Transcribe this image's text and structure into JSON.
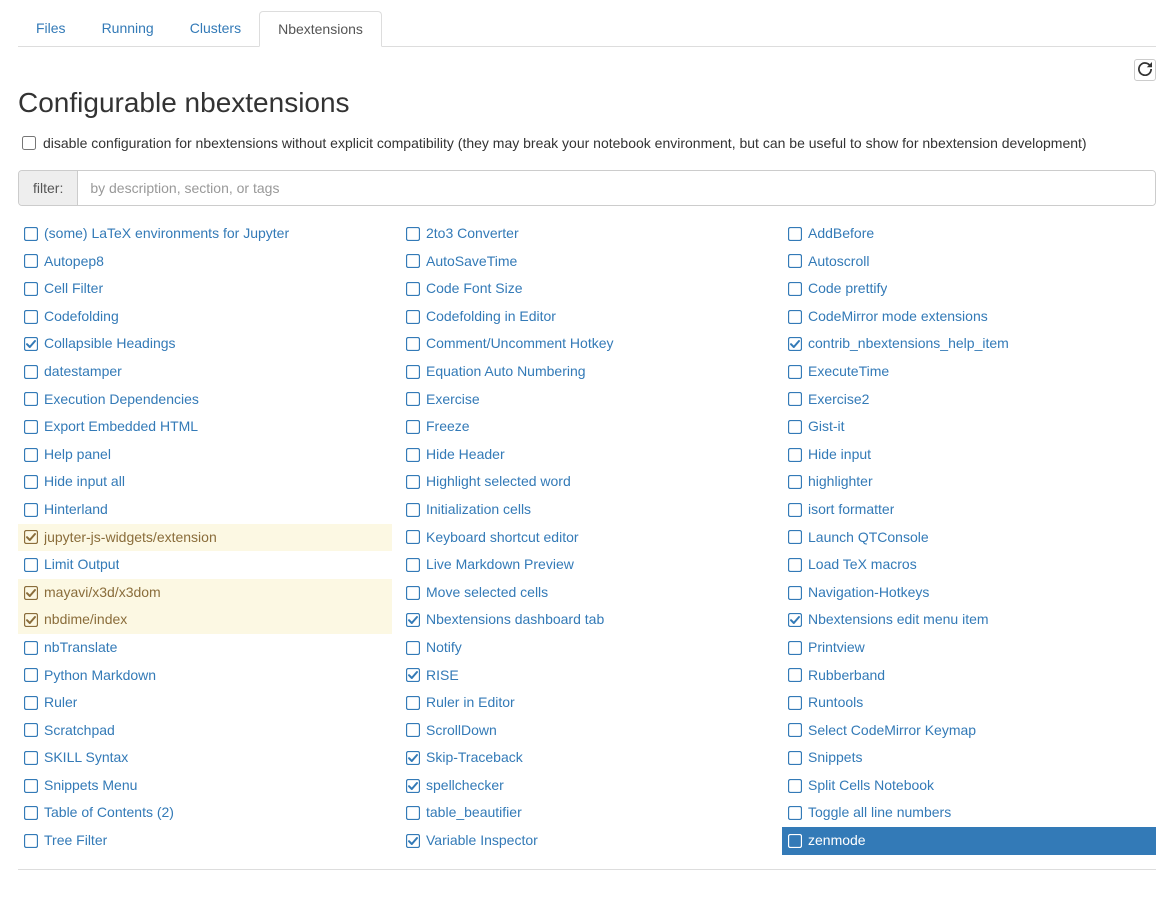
{
  "tabs": {
    "files": "Files",
    "running": "Running",
    "clusters": "Clusters",
    "nbextensions": "Nbextensions",
    "active": "nbextensions"
  },
  "title": "Configurable nbextensions",
  "disable_compat_label": "disable configuration for nbextensions without explicit compatibility (they may break your notebook environment, but can be useful to show for nbextension development)",
  "filter": {
    "label": "filter:",
    "placeholder": "by description, section, or tags"
  },
  "columns": [
    [
      {
        "label": "(some) LaTeX environments for Jupyter",
        "checked": false
      },
      {
        "label": "Autopep8",
        "checked": false
      },
      {
        "label": "Cell Filter",
        "checked": false
      },
      {
        "label": "Codefolding",
        "checked": false
      },
      {
        "label": "Collapsible Headings",
        "checked": true
      },
      {
        "label": "datestamper",
        "checked": false
      },
      {
        "label": "Execution Dependencies",
        "checked": false
      },
      {
        "label": "Export Embedded HTML",
        "checked": false
      },
      {
        "label": "Help panel",
        "checked": false
      },
      {
        "label": "Hide input all",
        "checked": false
      },
      {
        "label": "Hinterland",
        "checked": false
      },
      {
        "label": "jupyter-js-widgets/extension",
        "checked": true,
        "nocompat": true
      },
      {
        "label": "Limit Output",
        "checked": false
      },
      {
        "label": "mayavi/x3d/x3dom",
        "checked": true,
        "nocompat": true
      },
      {
        "label": "nbdime/index",
        "checked": true,
        "nocompat": true
      },
      {
        "label": "nbTranslate",
        "checked": false
      },
      {
        "label": "Python Markdown",
        "checked": false
      },
      {
        "label": "Ruler",
        "checked": false
      },
      {
        "label": "Scratchpad",
        "checked": false
      },
      {
        "label": "SKILL Syntax",
        "checked": false
      },
      {
        "label": "Snippets Menu",
        "checked": false
      },
      {
        "label": "Table of Contents (2)",
        "checked": false
      },
      {
        "label": "Tree Filter",
        "checked": false
      }
    ],
    [
      {
        "label": "2to3 Converter",
        "checked": false
      },
      {
        "label": "AutoSaveTime",
        "checked": false
      },
      {
        "label": "Code Font Size",
        "checked": false
      },
      {
        "label": "Codefolding in Editor",
        "checked": false
      },
      {
        "label": "Comment/Uncomment Hotkey",
        "checked": false
      },
      {
        "label": "Equation Auto Numbering",
        "checked": false
      },
      {
        "label": "Exercise",
        "checked": false
      },
      {
        "label": "Freeze",
        "checked": false
      },
      {
        "label": "Hide Header",
        "checked": false
      },
      {
        "label": "Highlight selected word",
        "checked": false
      },
      {
        "label": "Initialization cells",
        "checked": false
      },
      {
        "label": "Keyboard shortcut editor",
        "checked": false
      },
      {
        "label": "Live Markdown Preview",
        "checked": false
      },
      {
        "label": "Move selected cells",
        "checked": false
      },
      {
        "label": "Nbextensions dashboard tab",
        "checked": true
      },
      {
        "label": "Notify",
        "checked": false
      },
      {
        "label": "RISE",
        "checked": true
      },
      {
        "label": "Ruler in Editor",
        "checked": false
      },
      {
        "label": "ScrollDown",
        "checked": false
      },
      {
        "label": "Skip-Traceback",
        "checked": true
      },
      {
        "label": "spellchecker",
        "checked": true
      },
      {
        "label": "table_beautifier",
        "checked": false
      },
      {
        "label": "Variable Inspector",
        "checked": true
      }
    ],
    [
      {
        "label": "AddBefore",
        "checked": false
      },
      {
        "label": "Autoscroll",
        "checked": false
      },
      {
        "label": "Code prettify",
        "checked": false
      },
      {
        "label": "CodeMirror mode extensions",
        "checked": false
      },
      {
        "label": "contrib_nbextensions_help_item",
        "checked": true
      },
      {
        "label": "ExecuteTime",
        "checked": false
      },
      {
        "label": "Exercise2",
        "checked": false
      },
      {
        "label": "Gist-it",
        "checked": false
      },
      {
        "label": "Hide input",
        "checked": false
      },
      {
        "label": "highlighter",
        "checked": false
      },
      {
        "label": "isort formatter",
        "checked": false
      },
      {
        "label": "Launch QTConsole",
        "checked": false
      },
      {
        "label": "Load TeX macros",
        "checked": false
      },
      {
        "label": "Navigation-Hotkeys",
        "checked": false
      },
      {
        "label": "Nbextensions edit menu item",
        "checked": true
      },
      {
        "label": "Printview",
        "checked": false
      },
      {
        "label": "Rubberband",
        "checked": false
      },
      {
        "label": "Runtools",
        "checked": false
      },
      {
        "label": "Select CodeMirror Keymap",
        "checked": false
      },
      {
        "label": "Snippets",
        "checked": false
      },
      {
        "label": "Split Cells Notebook",
        "checked": false
      },
      {
        "label": "Toggle all line numbers",
        "checked": false
      },
      {
        "label": "zenmode",
        "checked": false,
        "selected": true
      }
    ]
  ]
}
